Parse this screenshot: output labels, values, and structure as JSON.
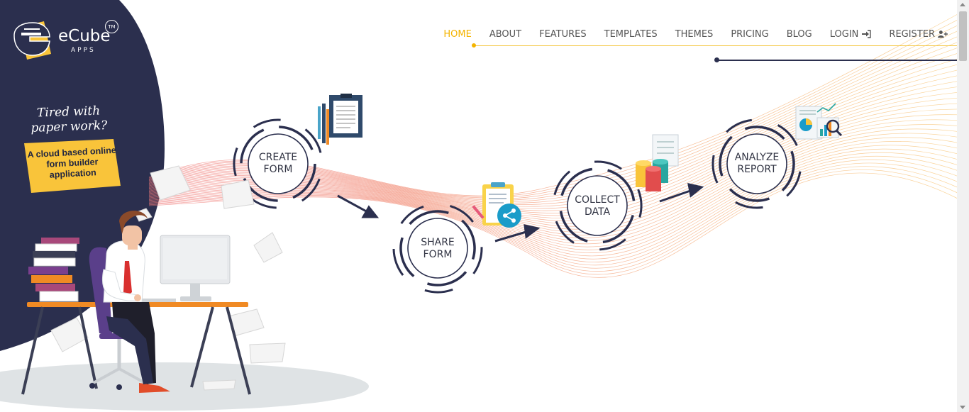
{
  "brand": {
    "name": "eCube",
    "sub": "APPS",
    "trademark": "TM"
  },
  "nav": {
    "items": [
      {
        "label": "HOME",
        "active": true
      },
      {
        "label": "ABOUT"
      },
      {
        "label": "FEATURES"
      },
      {
        "label": "TEMPLATES"
      },
      {
        "label": "THEMES"
      },
      {
        "label": "PRICING"
      },
      {
        "label": "BLOG"
      },
      {
        "label": "LOGIN",
        "icon": "login-icon"
      },
      {
        "label": "REGISTER",
        "icon": "user-plus-icon"
      }
    ]
  },
  "hero": {
    "tagline": "Tired with paper work?",
    "note": "A cloud based online form builder application"
  },
  "steps": [
    {
      "line1": "CREATE",
      "line2": "FORM",
      "icon": "clipboard-document-icon"
    },
    {
      "line1": "SHARE",
      "line2": "FORM",
      "icon": "share-form-icon"
    },
    {
      "line1": "COLLECT",
      "line2": "DATA",
      "icon": "database-stack-icon"
    },
    {
      "line1": "ANALYZE",
      "line2": "REPORT",
      "icon": "analytics-report-icon"
    }
  ],
  "colors": {
    "navy": "#2b2f4e",
    "accent": "#f4b400",
    "wave_start": "#f07a7a",
    "wave_end": "#f8c777",
    "orange": "#f08a24"
  }
}
